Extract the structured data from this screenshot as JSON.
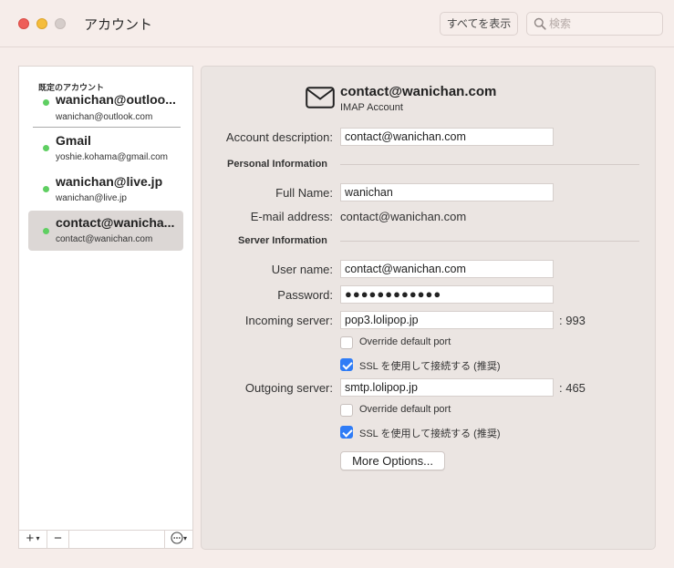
{
  "window": {
    "title": "アカウント",
    "show_all_label": "すべてを表示",
    "search_placeholder": "検索"
  },
  "sidebar": {
    "section_label": "既定のアカウント",
    "accounts": [
      {
        "name": "wanichan@outloo...",
        "email": "wanichan@outlook.com",
        "status_color": "#5fcf62"
      },
      {
        "name": "Gmail",
        "email": "yoshie.kohama@gmail.com",
        "status_color": "#5fcf62"
      },
      {
        "name": "wanichan@live.jp",
        "email": "wanichan@live.jp",
        "status_color": "#5fcf62"
      },
      {
        "name": "contact@wanicha...",
        "email": "contact@wanichan.com",
        "status_color": "#5fcf62",
        "selected": true
      }
    ],
    "toolbar": {
      "add": "+",
      "remove": "−",
      "action": "⋯"
    }
  },
  "detail": {
    "header_email": "contact@wanichan.com",
    "header_type": "IMAP Account",
    "account_description_label": "Account description:",
    "account_description_value": "contact@wanichan.com",
    "personal_section": "Personal Information",
    "full_name_label": "Full Name:",
    "full_name_value": "wanichan",
    "email_label": "E-mail address:",
    "email_value": "contact@wanichan.com",
    "server_section": "Server Information",
    "user_name_label": "User name:",
    "user_name_value": "contact@wanichan.com",
    "password_label": "Password:",
    "password_value": "●●●●●●●●●●●●",
    "incoming_label": "Incoming server:",
    "incoming_value": "pop3.lolipop.jp",
    "incoming_port": ": 993",
    "incoming_override_label": "Override default port",
    "incoming_override_checked": false,
    "incoming_ssl_label": "SSL を使用して接続する (推奨)",
    "incoming_ssl_checked": true,
    "outgoing_label": "Outgoing server:",
    "outgoing_value": "smtp.lolipop.jp",
    "outgoing_port": ": 465",
    "outgoing_override_label": "Override default port",
    "outgoing_override_checked": false,
    "outgoing_ssl_label": "SSL を使用して接続する (推奨)",
    "outgoing_ssl_checked": true,
    "more_options_label": "More Options..."
  },
  "colors": {
    "accent": "#2f7cf6",
    "online": "#5fcf62",
    "close": "#ee5e58",
    "minimize": "#f5bd3b"
  }
}
